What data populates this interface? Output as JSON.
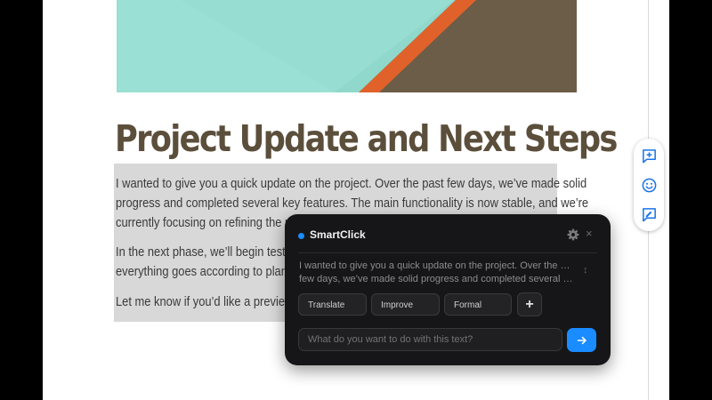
{
  "document": {
    "title": "Project Update and Next Steps",
    "paragraphs": [
      {
        "lines": [
          "I wanted to give you a quick update on the project. Over the past few days, we’ve made solid",
          "progress and completed several key features. The main functionality is now stable, and we’re",
          "currently focusing on refining the us"
        ]
      },
      {
        "lines": [
          "In the next phase, we’ll begin testin",
          "everything goes according to plan, w"
        ]
      },
      {
        "lines": [
          "Let me know if you’d like a preview"
        ]
      }
    ]
  },
  "side_toolbar": {
    "icons": [
      "add-comment-icon",
      "emoji-icon",
      "suggest-edit-icon"
    ]
  },
  "smartclick": {
    "title": "SmartClick",
    "icons": {
      "settings": "gear-icon",
      "close": "close-icon",
      "expand": "expand-icon",
      "send": "arrow-right-icon"
    },
    "excerpt_lines": [
      "I wanted to give you a quick update on the project. Over the past",
      "few days, we’ve made solid progress and completed several ke..."
    ],
    "actions": [
      "Translate",
      "Improve",
      "Formal"
    ],
    "add_label": "+",
    "prompt_placeholder": "What do you want to do with this text?",
    "close_label": "×",
    "expand_label": "↕",
    "colors": {
      "accent": "#1a8cff",
      "panel_bg": "#161618",
      "heading": "#5b4f3c",
      "selection": "#d8d8d8"
    }
  }
}
